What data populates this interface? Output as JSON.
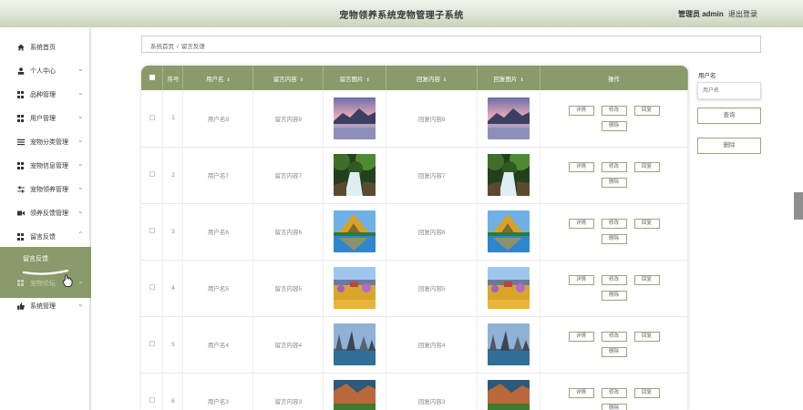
{
  "header": {
    "title": "宠物领养系统宠物管理子系统",
    "admin": "管理员 admin",
    "logout": "退出登录"
  },
  "sidebar": {
    "items": [
      {
        "label": "系统首页",
        "icon": "home-icon"
      },
      {
        "label": "个人中心",
        "icon": "user-icon"
      },
      {
        "label": "品种管理",
        "icon": "grid-icon"
      },
      {
        "label": "用户管理",
        "icon": "grid-icon"
      },
      {
        "label": "宠物分类管理",
        "icon": "menu-icon"
      },
      {
        "label": "宠物信息管理",
        "icon": "grid-icon"
      },
      {
        "label": "宠物领养管理",
        "icon": "sliders-icon"
      },
      {
        "label": "领养反馈管理",
        "icon": "video-icon"
      },
      {
        "label": "留言反馈",
        "icon": "grid-icon"
      }
    ],
    "active_sub": "留言反馈",
    "ghost_item": "宠物论坛",
    "last_item": {
      "label": "系统管理",
      "icon": "thumbs-up-icon"
    },
    "accent": "#8a9a6a"
  },
  "breadcrumb": {
    "home": "系统首页",
    "separator": "/",
    "current": "留言反馈"
  },
  "table": {
    "headers": {
      "index": "序号",
      "username": "用户名",
      "content": "留言内容",
      "image": "留言图片",
      "reply": "回复内容",
      "reply_image": "回复图片",
      "actions": "操作"
    },
    "rows": [
      {
        "index": "1",
        "username": "用户名8",
        "content": "留言内容8",
        "reply": "回复内容8",
        "scene": "lake-sunset"
      },
      {
        "index": "2",
        "username": "用户名7",
        "content": "留言内容7",
        "reply": "回复内容7",
        "scene": "forest-waterfall"
      },
      {
        "index": "3",
        "username": "用户名6",
        "content": "留言内容6",
        "reply": "回复内容6",
        "scene": "autumn-mountain"
      },
      {
        "index": "4",
        "username": "用户名5",
        "content": "留言内容5",
        "reply": "回复内容5",
        "scene": "flower-field"
      },
      {
        "index": "5",
        "username": "用户名4",
        "content": "留言内容4",
        "reply": "回复内容4",
        "scene": "rock-coast"
      },
      {
        "index": "6",
        "username": "用户名3",
        "content": "留言内容3",
        "reply": "回复内容3",
        "scene": "valley"
      }
    ],
    "buttons": {
      "detail": "详情",
      "edit": "修改",
      "reply": "回复",
      "delete": "删除"
    }
  },
  "search": {
    "label": "用户名",
    "placeholder": "用户名",
    "query_button": "查询",
    "delete_button": "删除"
  }
}
